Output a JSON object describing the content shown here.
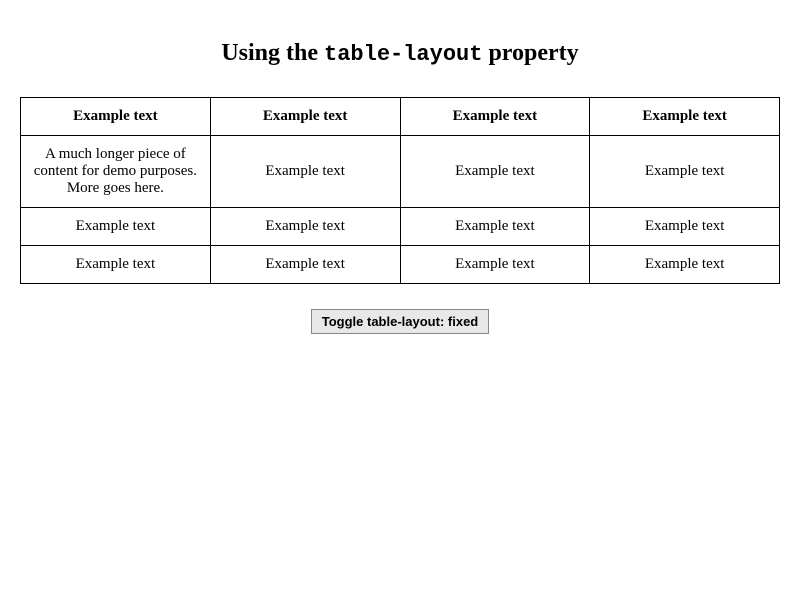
{
  "heading": {
    "prefix": "Using the ",
    "code": "table-layout",
    "suffix": " property"
  },
  "table": {
    "headers": [
      "Example text",
      "Example text",
      "Example text",
      "Example text"
    ],
    "rows": [
      [
        "A much longer piece of content for demo purposes. More goes here.",
        "Example text",
        "Example text",
        "Example text"
      ],
      [
        "Example text",
        "Example text",
        "Example text",
        "Example text"
      ],
      [
        "Example text",
        "Example text",
        "Example text",
        "Example text"
      ]
    ]
  },
  "button": {
    "label": "Toggle table-layout: fixed"
  }
}
